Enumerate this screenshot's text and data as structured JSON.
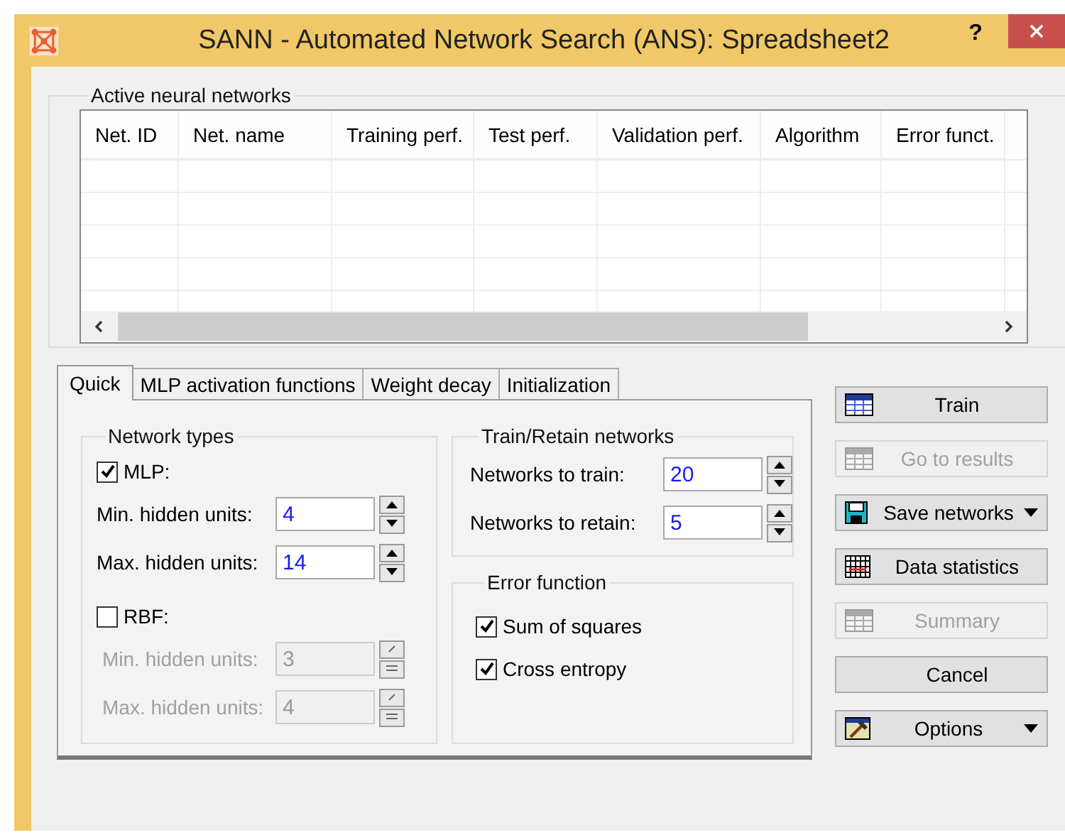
{
  "window": {
    "title": "SANN - Automated Network Search (ANS): Spreadsheet2",
    "help": "?"
  },
  "networks": {
    "title": "Active neural networks",
    "columns": [
      "Net. ID",
      "Net. name",
      "Training perf.",
      "Test perf.",
      "Validation perf.",
      "Algorithm",
      "Error funct."
    ]
  },
  "tabs": [
    {
      "label": "Quick",
      "selected": true
    },
    {
      "label": "MLP activation functions",
      "selected": false
    },
    {
      "label": "Weight decay",
      "selected": false
    },
    {
      "label": "Initialization",
      "selected": false
    }
  ],
  "network_types": {
    "title": "Network types",
    "options": [
      {
        "label": "MLP:",
        "checked": true,
        "fields": [
          {
            "label": "Min. hidden units:",
            "value": "4",
            "disabled": false
          },
          {
            "label": "Max. hidden units:",
            "value": "14",
            "disabled": false
          }
        ]
      },
      {
        "label": "RBF:",
        "checked": false,
        "fields": [
          {
            "label": "Min. hidden units:",
            "value": "3",
            "disabled": true
          },
          {
            "label": "Max. hidden units:",
            "value": "4",
            "disabled": true
          }
        ]
      }
    ]
  },
  "train_retain": {
    "title": "Train/Retain networks",
    "fields": [
      {
        "label": "Networks to train:",
        "value": "20"
      },
      {
        "label": "Networks to retain:",
        "value": "5"
      }
    ]
  },
  "error_function": {
    "title": "Error function",
    "options": [
      {
        "label": "Sum of squares",
        "checked": true
      },
      {
        "label": "Cross entropy",
        "checked": true
      }
    ]
  },
  "buttons": [
    {
      "label": "Train",
      "kind": "table",
      "disabled": false,
      "dropdown": false
    },
    {
      "label": "Go to results",
      "kind": "table",
      "disabled": true,
      "dropdown": false
    },
    {
      "label": "Save networks",
      "kind": "disk",
      "disabled": false,
      "dropdown": true
    },
    {
      "label": "Data statistics",
      "kind": "grid",
      "disabled": false,
      "dropdown": false
    },
    {
      "label": "Summary",
      "kind": "sum",
      "disabled": true,
      "dropdown": false
    },
    {
      "label": "Cancel",
      "kind": "plain",
      "disabled": false,
      "dropdown": false
    },
    {
      "label": "Options",
      "kind": "hammer",
      "disabled": false,
      "dropdown": true
    }
  ]
}
